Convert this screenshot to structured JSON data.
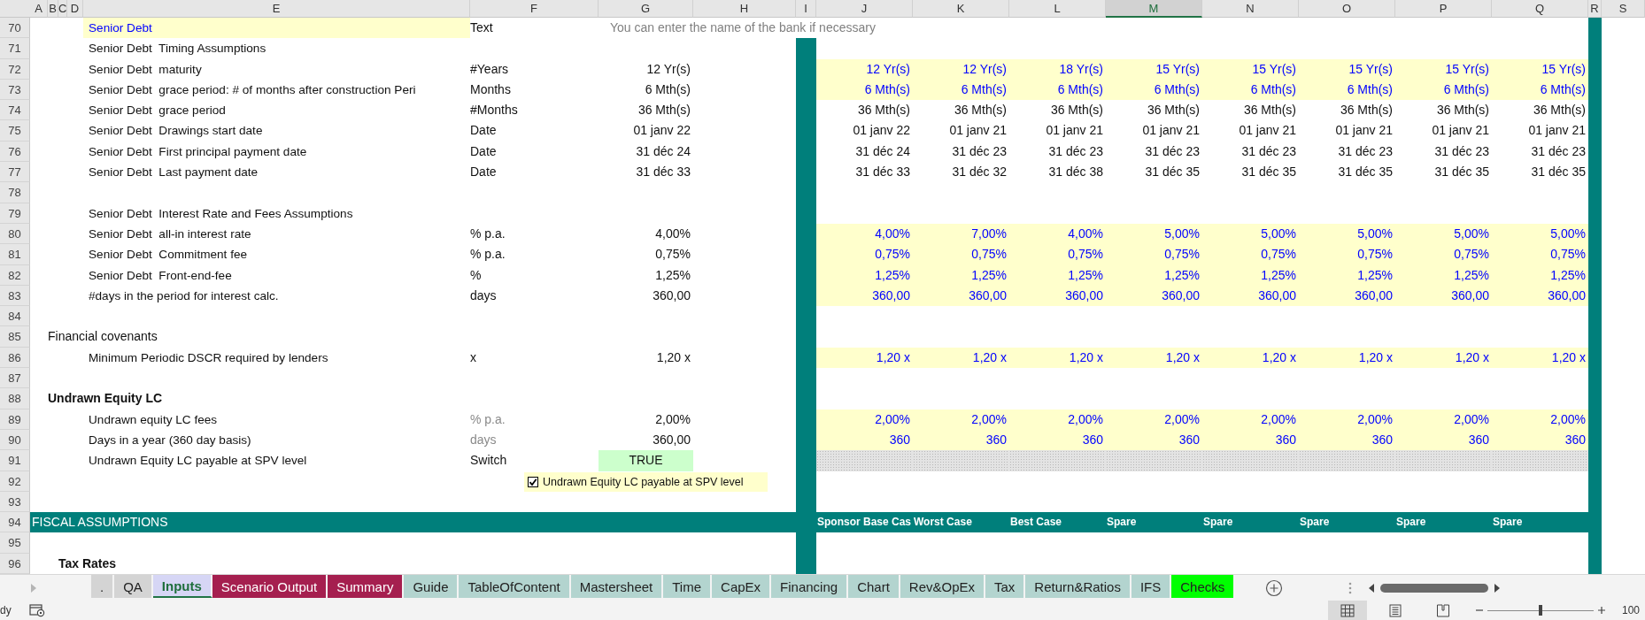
{
  "columns": [
    {
      "label": "A",
      "selected": false
    },
    {
      "label": "B",
      "selected": false
    },
    {
      "label": "C",
      "selected": false
    },
    {
      "label": "D",
      "selected": false
    },
    {
      "label": "E",
      "selected": false
    },
    {
      "label": "F",
      "selected": false
    },
    {
      "label": "G",
      "selected": false
    },
    {
      "label": "H",
      "selected": false
    },
    {
      "label": "I",
      "selected": false
    },
    {
      "label": "J",
      "selected": false
    },
    {
      "label": "K",
      "selected": false
    },
    {
      "label": "L",
      "selected": false
    },
    {
      "label": "M",
      "selected": true
    },
    {
      "label": "N",
      "selected": false
    },
    {
      "label": "O",
      "selected": false
    },
    {
      "label": "P",
      "selected": false
    },
    {
      "label": "Q",
      "selected": false
    },
    {
      "label": "R",
      "selected": false
    },
    {
      "label": "S",
      "selected": false
    }
  ],
  "rows": [
    {
      "number": "70",
      "kind": "item",
      "label": "Senior Debt",
      "label_input": true,
      "unit": "Text",
      "note": "You can enter the name of the bank if necessary"
    },
    {
      "number": "71",
      "kind": "item",
      "label": "Senior Debt  Timing Assumptions"
    },
    {
      "number": "72",
      "kind": "item",
      "label": "Senior Debt  maturity",
      "unit": "#Years",
      "value": "12 Yr(s)",
      "scenarios_input": true,
      "scenarios": [
        "12 Yr(s)",
        "12 Yr(s)",
        "18 Yr(s)",
        "15 Yr(s)",
        "15 Yr(s)",
        "15 Yr(s)",
        "15 Yr(s)",
        "15 Yr(s)"
      ]
    },
    {
      "number": "73",
      "kind": "item",
      "label": "Senior Debt  grace period: # of months after construction Peri",
      "unit": "Months",
      "value": "6 Mth(s)",
      "scenarios_input": true,
      "scenarios": [
        "6 Mth(s)",
        "6 Mth(s)",
        "6 Mth(s)",
        "6 Mth(s)",
        "6 Mth(s)",
        "6 Mth(s)",
        "6 Mth(s)",
        "6 Mth(s)"
      ]
    },
    {
      "number": "74",
      "kind": "item",
      "label": "Senior Debt  grace period",
      "unit": "#Months",
      "value": "36 Mth(s)",
      "scenarios_input": false,
      "scenarios": [
        "36 Mth(s)",
        "36 Mth(s)",
        "36 Mth(s)",
        "36 Mth(s)",
        "36 Mth(s)",
        "36 Mth(s)",
        "36 Mth(s)",
        "36 Mth(s)"
      ]
    },
    {
      "number": "75",
      "kind": "item",
      "label": "Senior Debt  Drawings start date",
      "unit": "Date",
      "value": "01 janv 22",
      "scenarios_input": false,
      "scenarios": [
        "01 janv 22",
        "01 janv 21",
        "01 janv 21",
        "01 janv 21",
        "01 janv 21",
        "01 janv 21",
        "01 janv 21",
        "01 janv 21"
      ]
    },
    {
      "number": "76",
      "kind": "item",
      "label": "Senior Debt  First principal payment date",
      "unit": "Date",
      "value": "31 déc 24",
      "scenarios_input": false,
      "scenarios": [
        "31 déc 24",
        "31 déc 23",
        "31 déc 23",
        "31 déc 23",
        "31 déc 23",
        "31 déc 23",
        "31 déc 23",
        "31 déc 23"
      ]
    },
    {
      "number": "77",
      "kind": "item",
      "label": "Senior Debt  Last payment date",
      "unit": "Date",
      "value": "31 déc 33",
      "scenarios_input": false,
      "scenarios": [
        "31 déc 33",
        "31 déc 32",
        "31 déc 38",
        "31 déc 35",
        "31 déc 35",
        "31 déc 35",
        "31 déc 35",
        "31 déc 35"
      ]
    },
    {
      "number": "78",
      "kind": "blank"
    },
    {
      "number": "79",
      "kind": "item",
      "label": "Senior Debt  Interest Rate and Fees Assumptions"
    },
    {
      "number": "80",
      "kind": "item",
      "label": "Senior Debt  all-in interest rate",
      "unit": "% p.a.",
      "value": "4,00%",
      "scenarios_input": true,
      "scenarios": [
        "4,00%",
        "7,00%",
        "4,00%",
        "5,00%",
        "5,00%",
        "5,00%",
        "5,00%",
        "5,00%"
      ]
    },
    {
      "number": "81",
      "kind": "item",
      "label": "Senior Debt  Commitment fee",
      "unit": "% p.a.",
      "value": "0,75%",
      "scenarios_input": true,
      "scenarios": [
        "0,75%",
        "0,75%",
        "0,75%",
        "0,75%",
        "0,75%",
        "0,75%",
        "0,75%",
        "0,75%"
      ]
    },
    {
      "number": "82",
      "kind": "item",
      "label": "Senior Debt  Front-end-fee",
      "unit": "%",
      "value": "1,25%",
      "scenarios_input": true,
      "scenarios": [
        "1,25%",
        "1,25%",
        "1,25%",
        "1,25%",
        "1,25%",
        "1,25%",
        "1,25%",
        "1,25%"
      ]
    },
    {
      "number": "83",
      "kind": "item",
      "label": "#days in the period for interest calc.",
      "unit": "days",
      "value": "360,00",
      "scenarios_input": true,
      "scenarios": [
        "360,00",
        "360,00",
        "360,00",
        "360,00",
        "360,00",
        "360,00",
        "360,00",
        "360,00"
      ]
    },
    {
      "number": "84",
      "kind": "blank"
    },
    {
      "number": "85",
      "kind": "group",
      "label": "Financial covenants",
      "bold": false
    },
    {
      "number": "86",
      "kind": "item",
      "label": "Minimum Periodic DSCR required by lenders",
      "unit": "x",
      "value": "1,20 x",
      "scenarios_input": true,
      "scenarios": [
        "1,20 x",
        "1,20 x",
        "1,20 x",
        "1,20 x",
        "1,20 x",
        "1,20 x",
        "1,20 x",
        "1,20 x"
      ]
    },
    {
      "number": "87",
      "kind": "blank"
    },
    {
      "number": "88",
      "kind": "group",
      "label": "Undrawn Equity LC",
      "bold": true
    },
    {
      "number": "89",
      "kind": "item",
      "label": "Undrawn equity LC fees",
      "unit": "% p.a.",
      "unit_muted": true,
      "value": "2,00%",
      "scenarios_input": true,
      "scenarios": [
        "2,00%",
        "2,00%",
        "2,00%",
        "2,00%",
        "2,00%",
        "2,00%",
        "2,00%",
        "2,00%"
      ]
    },
    {
      "number": "90",
      "kind": "item",
      "label": "Days in a year (360 day basis)",
      "unit": "days",
      "unit_muted": true,
      "value": "360,00",
      "scenarios_input": true,
      "scenarios": [
        "360",
        "360",
        "360",
        "360",
        "360",
        "360",
        "360",
        "360"
      ]
    },
    {
      "number": "91",
      "kind": "item",
      "label": "Undrawn Equity LC payable at SPV level",
      "unit": "Switch",
      "value": "TRUE",
      "value_switch": true,
      "scenarios_disabled": true
    },
    {
      "number": "92",
      "kind": "checkbox",
      "checkbox": {
        "text": "Undrawn Equity LC payable at SPV level",
        "checked": true
      }
    },
    {
      "number": "93",
      "kind": "blank"
    },
    {
      "number": "94",
      "kind": "section",
      "label": "FISCAL ASSUMPTIONS",
      "headers": [
        "Sponsor Base Cas",
        "Worst Case",
        "Best Case",
        "Spare",
        "Spare",
        "Spare",
        "Spare",
        "Spare"
      ]
    },
    {
      "number": "95",
      "kind": "blank"
    },
    {
      "number": "96",
      "kind": "subgroup",
      "label": "Tax Rates",
      "bold": true
    }
  ],
  "sheet_tabs": [
    {
      "label": ".",
      "color": "#d4d4d4",
      "selected": false
    },
    {
      "label": "QA",
      "color": "#d4d4d4",
      "selected": false
    },
    {
      "label": "Inputs",
      "color": "#d6d6f5",
      "selected": true
    },
    {
      "label": "Scenario Output",
      "color": "#a51f4f",
      "selected": false
    },
    {
      "label": "Summary",
      "color": "#a51f4f",
      "selected": false
    },
    {
      "label": "Guide",
      "color": "#b3d4cf",
      "selected": false
    },
    {
      "label": "TableOfContent",
      "color": "#b3d4cf",
      "selected": false
    },
    {
      "label": "Mastersheet",
      "color": "#b3d4cf",
      "selected": false
    },
    {
      "label": "Time",
      "color": "#b3d4cf",
      "selected": false
    },
    {
      "label": "CapEx",
      "color": "#b3d4cf",
      "selected": false
    },
    {
      "label": "Financing",
      "color": "#b3d4cf",
      "selected": false
    },
    {
      "label": "Chart",
      "color": "#b3d4cf",
      "selected": false
    },
    {
      "label": "Rev&OpEx",
      "color": "#b3d4cf",
      "selected": false
    },
    {
      "label": "Tax",
      "color": "#b3d4cf",
      "selected": false
    },
    {
      "label": "Return&Ratios",
      "color": "#b3d4cf",
      "selected": false
    },
    {
      "label": "IFS",
      "color": "#b3d4cf",
      "selected": false
    },
    {
      "label": "Checks",
      "color": "#00ff00",
      "selected": false
    }
  ],
  "status_bar": {
    "status": "dy",
    "views": [
      {
        "kind": "normal",
        "selected": true
      },
      {
        "kind": "page_layout",
        "selected": false
      },
      {
        "kind": "page_break",
        "selected": false
      }
    ],
    "zoom": {
      "level": 0.5,
      "reading": "100"
    }
  }
}
